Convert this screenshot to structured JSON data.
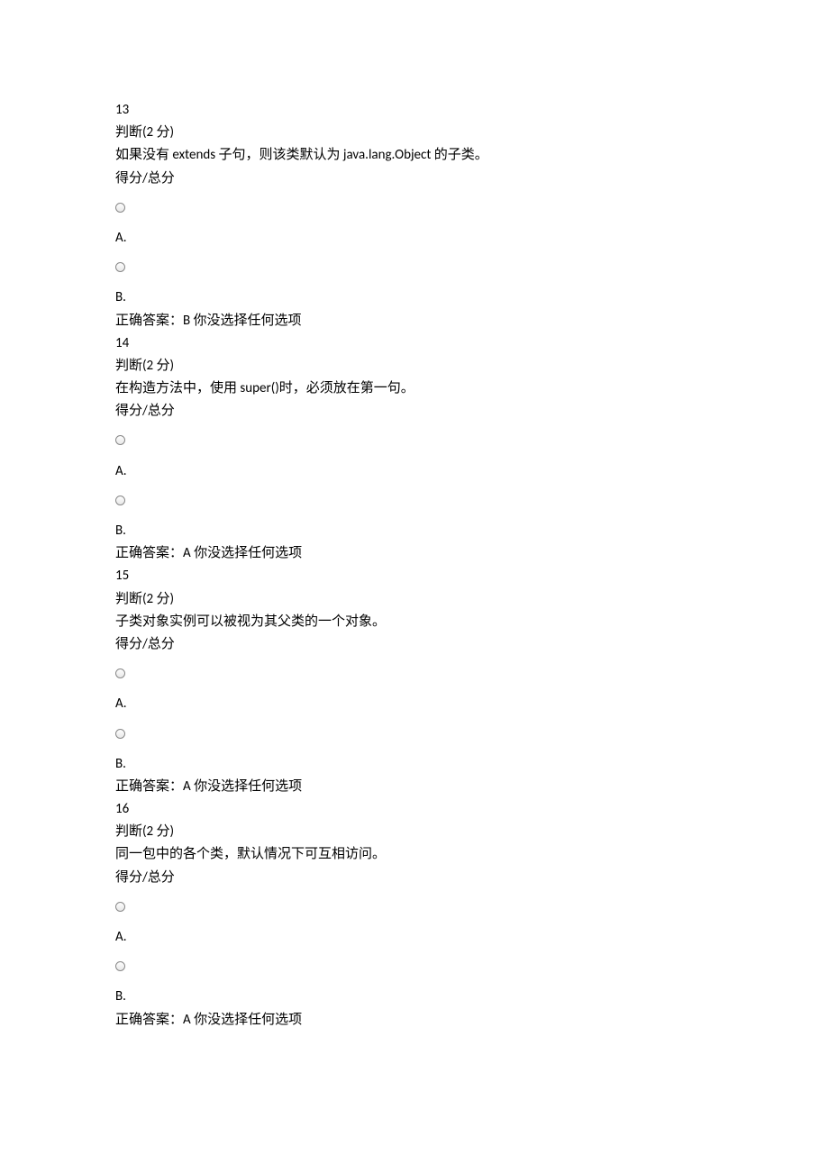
{
  "questions": [
    {
      "number": "13",
      "type_and_points": "判断(2 分)",
      "stem": "如果没有 extends 子句，则该类默认为 java.lang.Object 的子类。",
      "score_label": "得分/总分",
      "option_a": "A.",
      "option_b": "B.",
      "answer": "正确答案：B 你没选择任何选项"
    },
    {
      "number": "14",
      "type_and_points": "判断(2 分)",
      "stem": "在构造方法中，使用 super()时，必须放在第一句。",
      "score_label": "得分/总分",
      "option_a": "A.",
      "option_b": "B.",
      "answer": "正确答案：A 你没选择任何选项"
    },
    {
      "number": "15",
      "type_and_points": "判断(2 分)",
      "stem": "子类对象实例可以被视为其父类的一个对象。",
      "score_label": "得分/总分",
      "option_a": "A.",
      "option_b": "B.",
      "answer": "正确答案：A 你没选择任何选项"
    },
    {
      "number": "16",
      "type_and_points": "判断(2 分)",
      "stem": "同一包中的各个类，默认情况下可互相访问。",
      "score_label": "得分/总分",
      "option_a": "A.",
      "option_b": "B.",
      "answer": "正确答案：A 你没选择任何选项"
    }
  ]
}
